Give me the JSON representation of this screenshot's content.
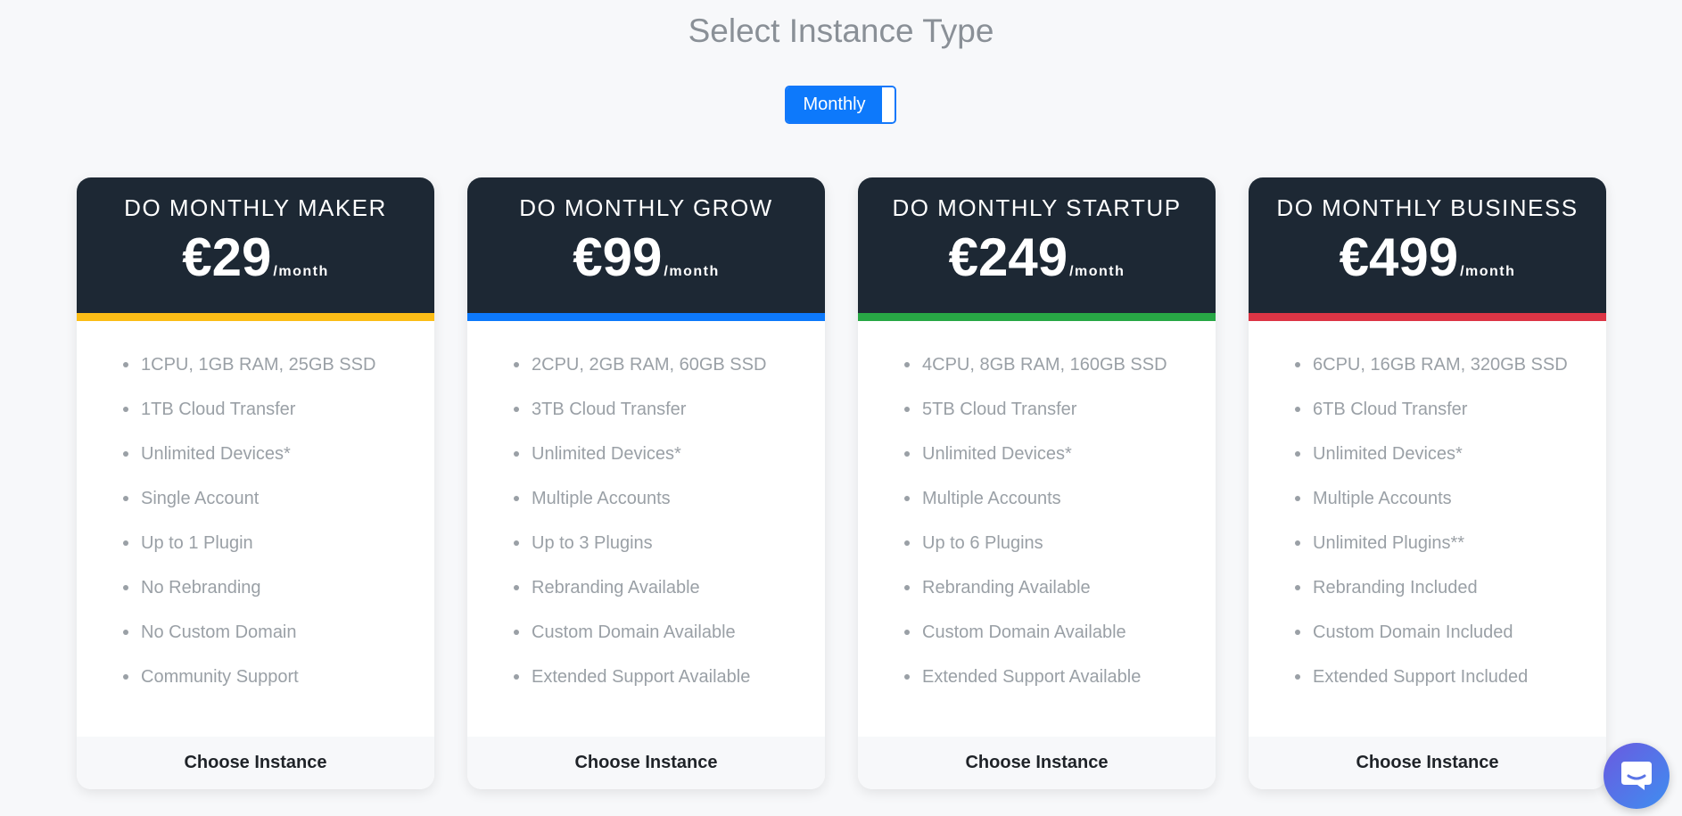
{
  "header": {
    "title": "Select Instance Type"
  },
  "billing_toggle": {
    "label": "Monthly"
  },
  "colors": {
    "card_header": "#1d2834",
    "toggle_active": "#0d79fb",
    "chat_gradient_start": "#6a5ae0",
    "chat_gradient_end": "#3f8ef0"
  },
  "plans": [
    {
      "name": "DO MONTHLY MAKER",
      "price": "€29",
      "period": "/month",
      "accent": "#fbbd17",
      "features": [
        "1CPU, 1GB RAM, 25GB SSD",
        "1TB Cloud Transfer",
        "Unlimited Devices*",
        "Single Account",
        "Up to 1 Plugin",
        "No Rebranding",
        "No Custom Domain",
        "Community Support"
      ],
      "cta": "Choose Instance"
    },
    {
      "name": "DO MONTHLY GROW",
      "price": "€99",
      "period": "/month",
      "accent": "#0d79fb",
      "features": [
        "2CPU, 2GB RAM, 60GB SSD",
        "3TB Cloud Transfer",
        "Unlimited Devices*",
        "Multiple Accounts",
        "Up to 3 Plugins",
        "Rebranding Available",
        "Custom Domain Available",
        "Extended Support Available"
      ],
      "cta": "Choose Instance"
    },
    {
      "name": "DO MONTHLY STARTUP",
      "price": "€249",
      "period": "/month",
      "accent": "#28a745",
      "features": [
        "4CPU, 8GB RAM, 160GB SSD",
        "5TB Cloud Transfer",
        "Unlimited Devices*",
        "Multiple Accounts",
        "Up to 6 Plugins",
        "Rebranding Available",
        "Custom Domain Available",
        "Extended Support Available"
      ],
      "cta": "Choose Instance"
    },
    {
      "name": "DO MONTHLY BUSINESS",
      "price": "€499",
      "period": "/month",
      "accent": "#dc3545",
      "features": [
        "6CPU, 16GB RAM, 320GB SSD",
        "6TB Cloud Transfer",
        "Unlimited Devices*",
        "Multiple Accounts",
        "Unlimited Plugins**",
        "Rebranding Included",
        "Custom Domain Included",
        "Extended Support Included"
      ],
      "cta": "Choose Instance"
    }
  ],
  "chat_widget": {
    "icon": "chat-bubble-icon"
  }
}
